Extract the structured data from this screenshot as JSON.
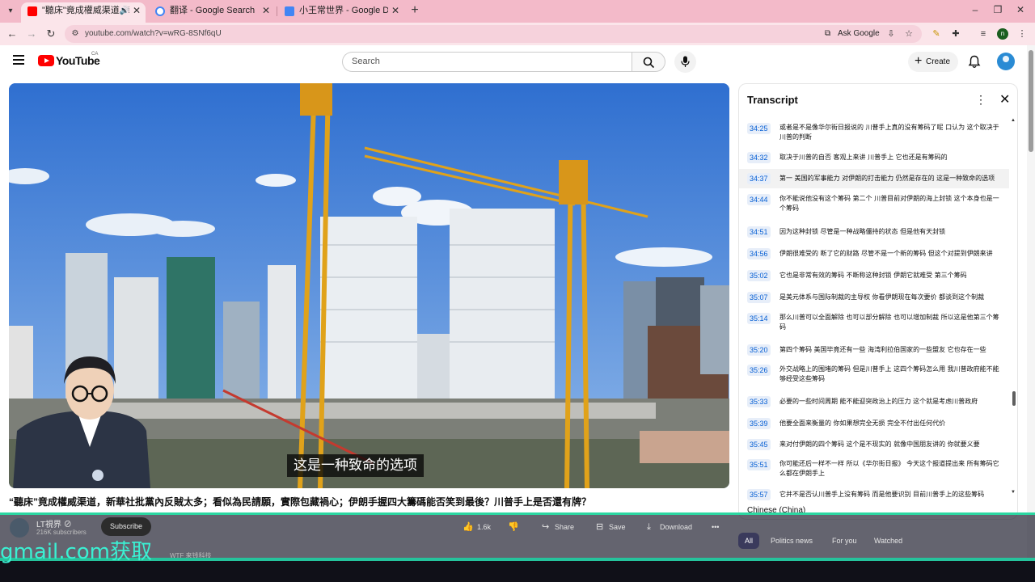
{
  "browser": {
    "tabs": [
      {
        "title": "\"聽床\"竟成權威渠道，新華",
        "active": true,
        "favicon_color": "#ff0000"
      },
      {
        "title": "翻译 - Google Search",
        "active": false,
        "favicon_color": "#4285f4"
      },
      {
        "title": "小王常世界 - Google Docs",
        "active": false,
        "favicon_color": "#4285f4"
      }
    ],
    "url": "youtube.com/watch?v=wRG-8SNf6qU",
    "ask_google": "Ask Google",
    "profile_letter": "n"
  },
  "youtube": {
    "logo_text": "YouTube",
    "country_code": "CA",
    "search_placeholder": "Search",
    "create_label": "Create"
  },
  "video": {
    "caption": "这是一种致命的选项",
    "title": "“聽床”竟成權威渠道，新華社批黨內反賊太多；看似為民請願，實際包藏禍心；伊朗手握四大籌碼能否笑到最後？川普手上是否還有牌？"
  },
  "channel": {
    "name": "LT視界 ⊘",
    "subscribers": "216K subscribers",
    "subscribe_label": "Subscribe"
  },
  "actions": {
    "likes": "1.6k",
    "share": "Share",
    "save": "Save",
    "download": "Download"
  },
  "transcript": {
    "title": "Transcript",
    "language": "Chinese (China)",
    "rows": [
      {
        "time": "34:25",
        "text": "或者是不是像华尔街日报说的 川普手上真的没有筹码了呢 口认为 这个取决于川普的判断"
      },
      {
        "time": "34:32",
        "text": "取决于川普的自否 客观上来讲 川普手上 它也还是有筹码的"
      },
      {
        "time": "34:37",
        "text": "第一 美国的军事能力 对伊朗的打击能力 仍然是存在的 这是一种致命的选项"
      },
      {
        "time": "34:44",
        "text": "你不能说他没有这个筹码 第二个 川普目前对伊朗的海上封锁 这个本身也是一个筹码"
      },
      {
        "time": "34:51",
        "text": "因为这种封锁 尽管是一种战略僵持的状态 但是他有天封锁"
      },
      {
        "time": "34:56",
        "text": "伊朗很难受的 断了它的财路 尽管不是一个新的筹码 但这个对提到伊朗来讲"
      },
      {
        "time": "35:02",
        "text": "它也是非常有效的筹码 不断称这种封锁 伊朗它就难受 第三个筹码"
      },
      {
        "time": "35:07",
        "text": "是美元体系与国际制裁的主导权 你看伊朗现在每次要价 都谈到这个制裁"
      },
      {
        "time": "35:14",
        "text": "那么川普可以全面解除 也可以部分解除 也可以增加制裁 所以这是他第三个筹码"
      },
      {
        "time": "35:20",
        "text": "第四个筹码 美国毕竟还有一些 海湾利拉伯国家的一些盟友 它也存在一些"
      },
      {
        "time": "35:26",
        "text": "外交战略上的围堵的筹码 但是川普手上 这四个筹码怎么用 我川普政府能不能够经受这些筹码"
      },
      {
        "time": "35:33",
        "text": "必要的一些时间周期 能不能迎突政治上的压力 这个就是考虑川普政府"
      },
      {
        "time": "35:39",
        "text": "他要全面来衡量的 你如果想完全无损 完全不付出任何代价"
      },
      {
        "time": "35:45",
        "text": "来对付伊朗的四个筹码 这个是不现实的 就像中国朋友讲的 你就要义要"
      },
      {
        "time": "35:51",
        "text": "你可能还后一样不一样 所以《华尔街日报》 今天这个报道提出来 所有筹码它么都在伊朗手上"
      },
      {
        "time": "35:57",
        "text": "它并不是否认川普手上没有筹码 而是他要识别 目前川普手上的这些筹码"
      }
    ]
  },
  "filter_chips": [
    "All",
    "Politics news",
    "For you",
    "Watched"
  ],
  "overlay": {
    "promo_text": "gmail.com获取",
    "under_text": "WTF 来钱科技"
  }
}
